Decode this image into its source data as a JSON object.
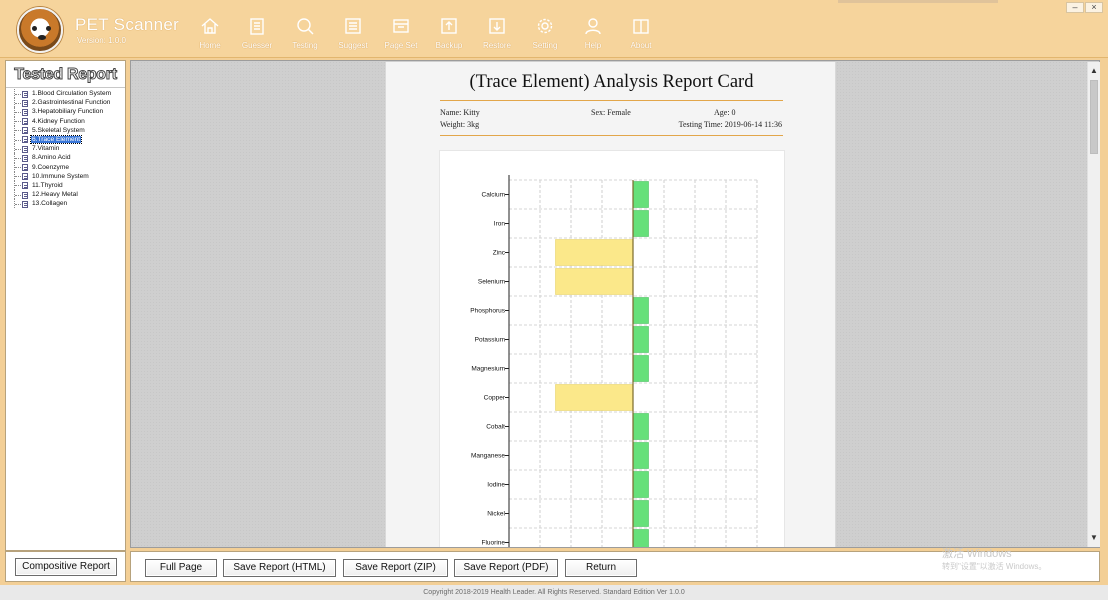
{
  "app": {
    "title": "PET Scanner",
    "version": "Version: 1.0.0"
  },
  "nav": [
    {
      "label": "Home",
      "icon": "home-icon"
    },
    {
      "label": "Guesser",
      "icon": "clipboard-icon"
    },
    {
      "label": "Testing",
      "icon": "magnifier-icon"
    },
    {
      "label": "Suggest",
      "icon": "list-icon"
    },
    {
      "label": "Page Set",
      "icon": "page-icon"
    },
    {
      "label": "Backup",
      "icon": "upload-icon"
    },
    {
      "label": "Restore",
      "icon": "download-icon"
    },
    {
      "label": "Setting",
      "icon": "gear-icon"
    },
    {
      "label": "Help",
      "icon": "person-icon"
    },
    {
      "label": "About",
      "icon": "book-icon"
    }
  ],
  "window_controls": {
    "minimize": "–",
    "close": "×"
  },
  "sidebar": {
    "title": "Tested Report",
    "items": [
      "1.Blood Circulation System",
      "2.Gastrointestinal Function",
      "3.Hepatobiliary Function",
      "4.Kidney Function",
      "5.Skeletal System",
      "6.Trace Element",
      "7.Vitamin",
      "8.Amino Acid",
      "9.Coenzyme",
      "10.Immune System",
      "11.Thyroid",
      "12.Heavy Metal",
      "13.Collagen"
    ],
    "selected_index": 5
  },
  "report": {
    "title": "(Trace Element) Analysis Report Card",
    "name": "Name: Kitty",
    "sex": "Sex: Female",
    "age": "Age: 0",
    "weight": "Weight: 3kg",
    "testing_time": "Testing Time: 2019-06-14 11:36"
  },
  "chart_data": {
    "type": "bar",
    "orientation": "horizontal",
    "categories": [
      "Calcium",
      "Iron",
      "Zinc",
      "Selenium",
      "Phosphorus",
      "Potassium",
      "Magnesium",
      "Copper",
      "Cobalt",
      "Manganese",
      "Iodine",
      "Nickel",
      "Fluorine"
    ],
    "values": [
      0.5,
      0.5,
      -2.5,
      -2.5,
      0.5,
      0.5,
      0.5,
      -2.5,
      0.5,
      0.5,
      0.5,
      0.5,
      0.5
    ],
    "bar_colors": [
      "#66e07a",
      "#66e07a",
      "#fbe88a",
      "#fbe88a",
      "#66e07a",
      "#66e07a",
      "#66e07a",
      "#fbe88a",
      "#66e07a",
      "#66e07a",
      "#66e07a",
      "#66e07a",
      "#66e07a"
    ],
    "xlim": [
      -4,
      4
    ],
    "grid": true,
    "title": "",
    "xlabel": "",
    "ylabel": ""
  },
  "buttons": {
    "compositive": "Compositive Report",
    "full_page": "Full Page",
    "save_html": "Save Report (HTML)",
    "save_zip": "Save Report (ZIP)",
    "save_pdf": "Save Report (PDF)",
    "return": "Return"
  },
  "watermark": {
    "line1": "激活 Windows",
    "line2": "转到\"设置\"以激活 Windows。"
  },
  "footer": "Copyright 2018-2019 Health Leader. All Rights Reserved.  Standard Edition Ver 1.0.0"
}
